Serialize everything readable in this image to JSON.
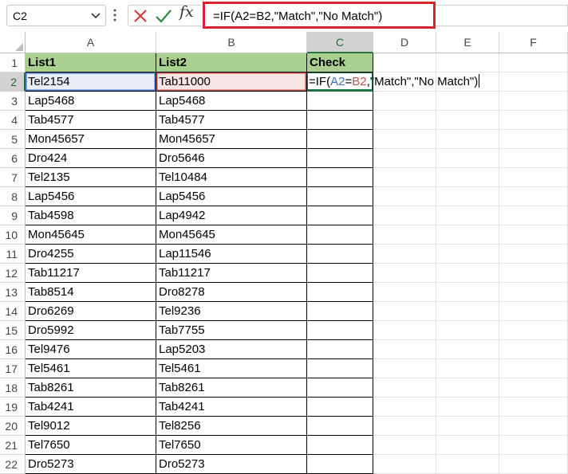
{
  "formula_bar": {
    "name_box": "C2",
    "formula": "=IF(A2=B2,\"Match\",\"No Match\")",
    "highlight_color": "#d72230"
  },
  "columns": [
    "A",
    "B",
    "C",
    "D",
    "E",
    "F"
  ],
  "active_column": "C",
  "active_row": "2",
  "headers": {
    "list1": "List1",
    "list2": "List2",
    "check": "Check"
  },
  "editing_cell": {
    "prefix": "=IF(",
    "ref1": "A2",
    "eq": "=",
    "ref2": "B2",
    "suffix": ",\"Match\",\"No Match\")"
  },
  "rows": [
    {
      "num": "1",
      "a": "List1",
      "b": "List2"
    },
    {
      "num": "2",
      "a": "Tel2154",
      "b": "Tab11000"
    },
    {
      "num": "3",
      "a": "Lap5468",
      "b": "Lap5468"
    },
    {
      "num": "4",
      "a": "Tab4577",
      "b": "Tab4577"
    },
    {
      "num": "5",
      "a": "Mon45657",
      "b": "Mon45657"
    },
    {
      "num": "6",
      "a": "Dro424",
      "b": "Dro5646"
    },
    {
      "num": "7",
      "a": "Tel2135",
      "b": "Tel10484"
    },
    {
      "num": "8",
      "a": "Lap5456",
      "b": "Lap5456"
    },
    {
      "num": "9",
      "a": "Tab4598",
      "b": "Lap4942"
    },
    {
      "num": "10",
      "a": "Mon45645",
      "b": "Mon45645"
    },
    {
      "num": "11",
      "a": "Dro4255",
      "b": "Lap11546"
    },
    {
      "num": "12",
      "a": "Tab11217",
      "b": "Tab11217"
    },
    {
      "num": "13",
      "a": "Tab8514",
      "b": "Dro8278"
    },
    {
      "num": "14",
      "a": "Dro6269",
      "b": "Tel9236"
    },
    {
      "num": "15",
      "a": "Dro5992",
      "b": "Tab7755"
    },
    {
      "num": "16",
      "a": "Tel9476",
      "b": "Lap5203"
    },
    {
      "num": "17",
      "a": "Tel5461",
      "b": "Tel5461"
    },
    {
      "num": "18",
      "a": "Tab8261",
      "b": "Tab8261"
    },
    {
      "num": "19",
      "a": "Tab4241",
      "b": "Tab4241"
    },
    {
      "num": "20",
      "a": "Tel9012",
      "b": "Tel8256"
    },
    {
      "num": "21",
      "a": "Tel7650",
      "b": "Tel7650"
    },
    {
      "num": "22",
      "a": "Dro5273",
      "b": "Dro5273"
    }
  ]
}
